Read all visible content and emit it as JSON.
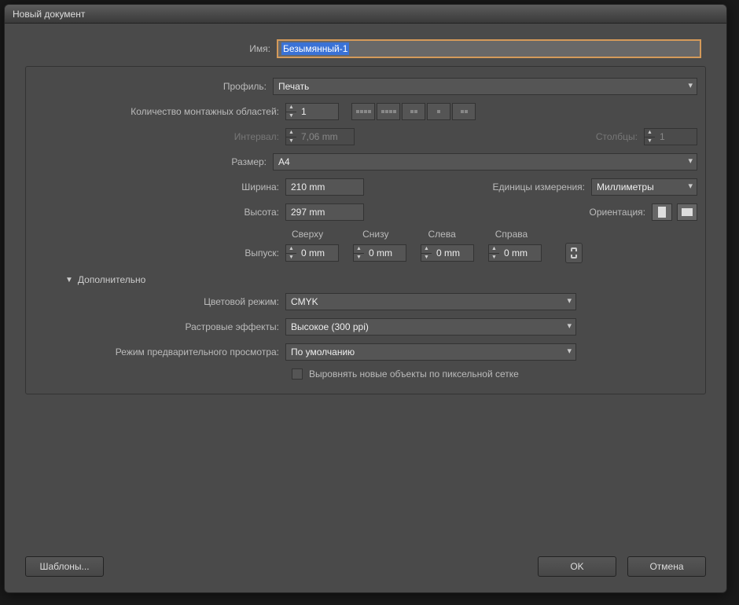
{
  "window": {
    "title": "Новый документ"
  },
  "form": {
    "name_label": "Имя:",
    "name_value": "Безымянный-1",
    "profile_label": "Профиль:",
    "profile_value": "Печать",
    "artboards_label": "Количество монтажных областей:",
    "artboards_value": "1",
    "spacing_label": "Интервал:",
    "spacing_value": "7,06 mm",
    "columns_label": "Столбцы:",
    "columns_value": "1",
    "size_label": "Размер:",
    "size_value": "A4",
    "width_label": "Ширина:",
    "width_value": "210 mm",
    "height_label": "Высота:",
    "height_value": "297 mm",
    "units_label": "Единицы измерения:",
    "units_value": "Миллиметры",
    "orientation_label": "Ориентация:",
    "bleed_label": "Выпуск:",
    "bleed_top_label": "Сверху",
    "bleed_bottom_label": "Снизу",
    "bleed_left_label": "Слева",
    "bleed_right_label": "Справа",
    "bleed_top": "0 mm",
    "bleed_bottom": "0 mm",
    "bleed_left": "0 mm",
    "bleed_right": "0 mm",
    "advanced_label": "Дополнительно",
    "color_mode_label": "Цветовой режим:",
    "color_mode_value": "CMYK",
    "raster_label": "Растровые эффекты:",
    "raster_value": "Высокое (300 ppi)",
    "preview_label": "Режим предварительного просмотра:",
    "preview_value": "По умолчанию",
    "align_grid_label": "Выровнять новые объекты по пиксельной сетке"
  },
  "buttons": {
    "templates": "Шаблоны...",
    "ok": "OK",
    "cancel": "Отмена"
  }
}
